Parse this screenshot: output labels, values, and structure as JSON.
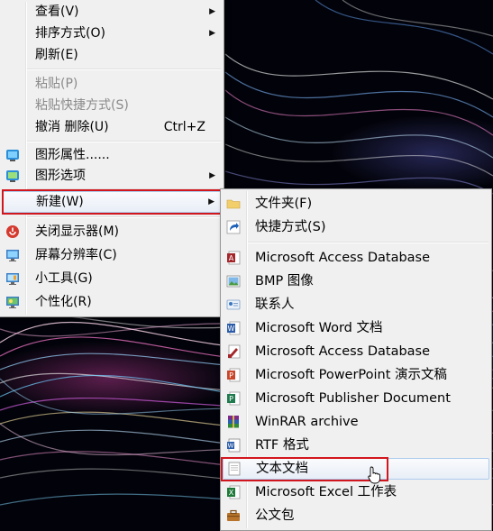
{
  "main_menu": {
    "items": [
      {
        "label": "查看(V)"
      },
      {
        "label": "排序方式(O)"
      },
      {
        "label": "刷新(E)"
      },
      {
        "label": "粘贴(P)"
      },
      {
        "label": "粘贴快捷方式(S)"
      },
      {
        "label": "撤消 删除(U)",
        "shortcut": "Ctrl+Z"
      },
      {
        "label": "图形属性......"
      },
      {
        "label": "图形选项"
      },
      {
        "label": "新建(W)"
      },
      {
        "label": "关闭显示器(M)"
      },
      {
        "label": "屏幕分辨率(C)"
      },
      {
        "label": "小工具(G)"
      },
      {
        "label": "个性化(R)"
      }
    ]
  },
  "sub_menu": {
    "items": [
      {
        "label": "文件夹(F)",
        "icon": "folder-icon"
      },
      {
        "label": "快捷方式(S)",
        "icon": "shortcut-icon"
      },
      {
        "label": "Microsoft Access Database",
        "icon": "access-icon"
      },
      {
        "label": "BMP 图像",
        "icon": "bmp-icon"
      },
      {
        "label": "联系人",
        "icon": "contact-icon"
      },
      {
        "label": "Microsoft Word 文档",
        "icon": "word-icon"
      },
      {
        "label": "Microsoft Access Database",
        "icon": "access-icon"
      },
      {
        "label": "Microsoft PowerPoint 演示文稿",
        "icon": "powerpoint-icon"
      },
      {
        "label": "Microsoft Publisher Document",
        "icon": "publisher-icon"
      },
      {
        "label": "WinRAR archive",
        "icon": "winrar-icon"
      },
      {
        "label": "RTF 格式",
        "icon": "rtf-icon"
      },
      {
        "label": "文本文档",
        "icon": "text-document-icon"
      },
      {
        "label": "Microsoft Excel 工作表",
        "icon": "excel-icon"
      },
      {
        "label": "公文包",
        "icon": "briefcase-icon"
      }
    ]
  },
  "colors": {
    "menu_bg": "#f0f0f0",
    "highlight_frame": "#d2161d",
    "disabled_text": "#8a8a8a"
  }
}
